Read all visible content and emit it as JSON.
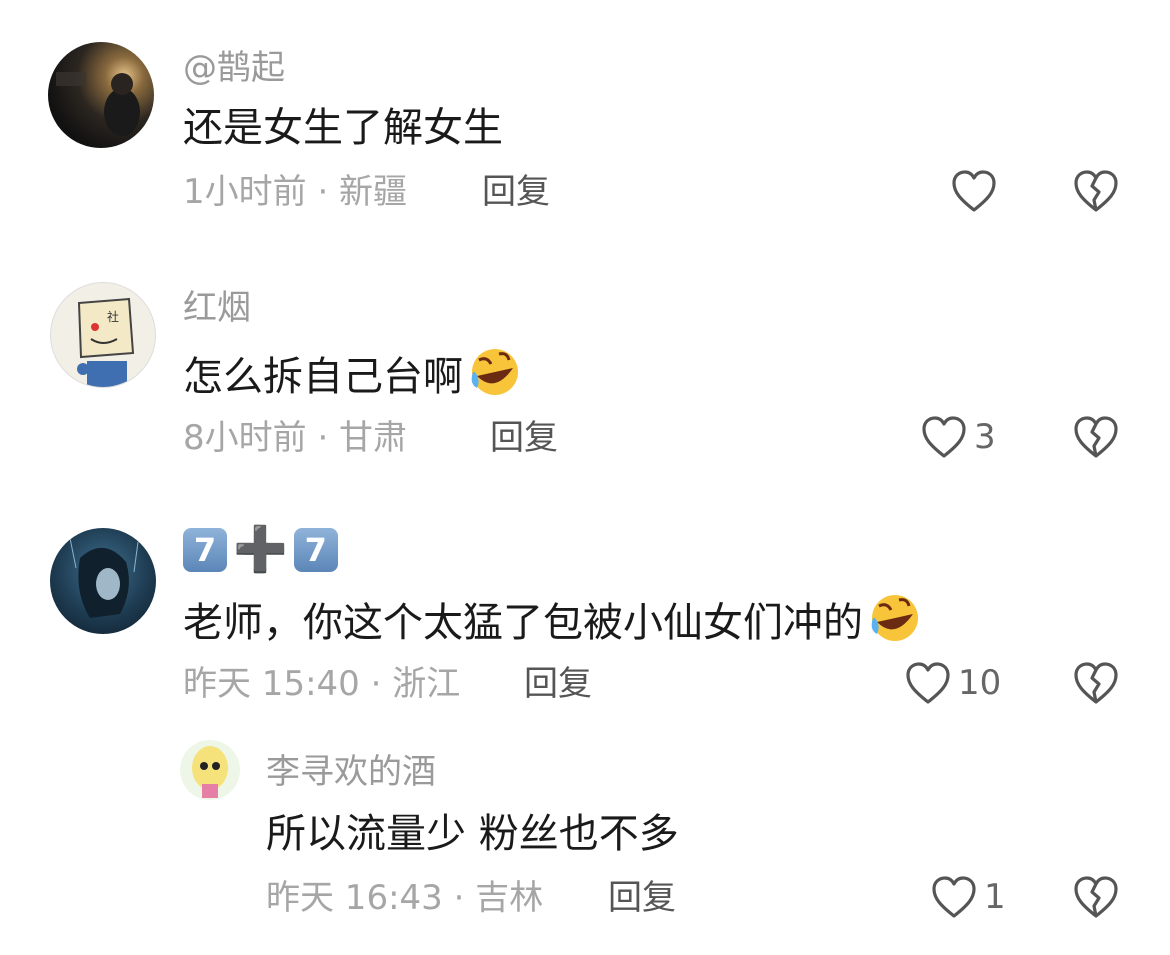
{
  "comments": [
    {
      "username": "@鹊起",
      "text": "还是女生了解女生",
      "time": "1小时前 · 新疆",
      "reply_label": "回复",
      "likes": ""
    },
    {
      "username": "红烟",
      "text": "怎么拆自己台啊",
      "time": "8小时前 · 甘肃",
      "reply_label": "回复",
      "likes": "3"
    },
    {
      "username_parts": [
        "7",
        "➕",
        "7"
      ],
      "text": "老师，你这个太猛了包被小仙女们冲的",
      "time": "昨天 15:40 · 浙江",
      "reply_label": "回复",
      "likes": "10"
    },
    {
      "username": "李寻欢的酒",
      "text": "所以流量少 粉丝也不多",
      "time": "昨天 16:43 · 吉林",
      "reply_label": "回复",
      "likes": "1"
    }
  ],
  "icons": {
    "like": "heart-outline-icon",
    "dislike": "broken-heart-icon",
    "emoji": "rolling-on-floor-laughing-emoji"
  },
  "colors": {
    "username": "#9a9a9a",
    "text": "#1a1a1a",
    "meta": "#a6a6a6",
    "icon": "#555555"
  }
}
